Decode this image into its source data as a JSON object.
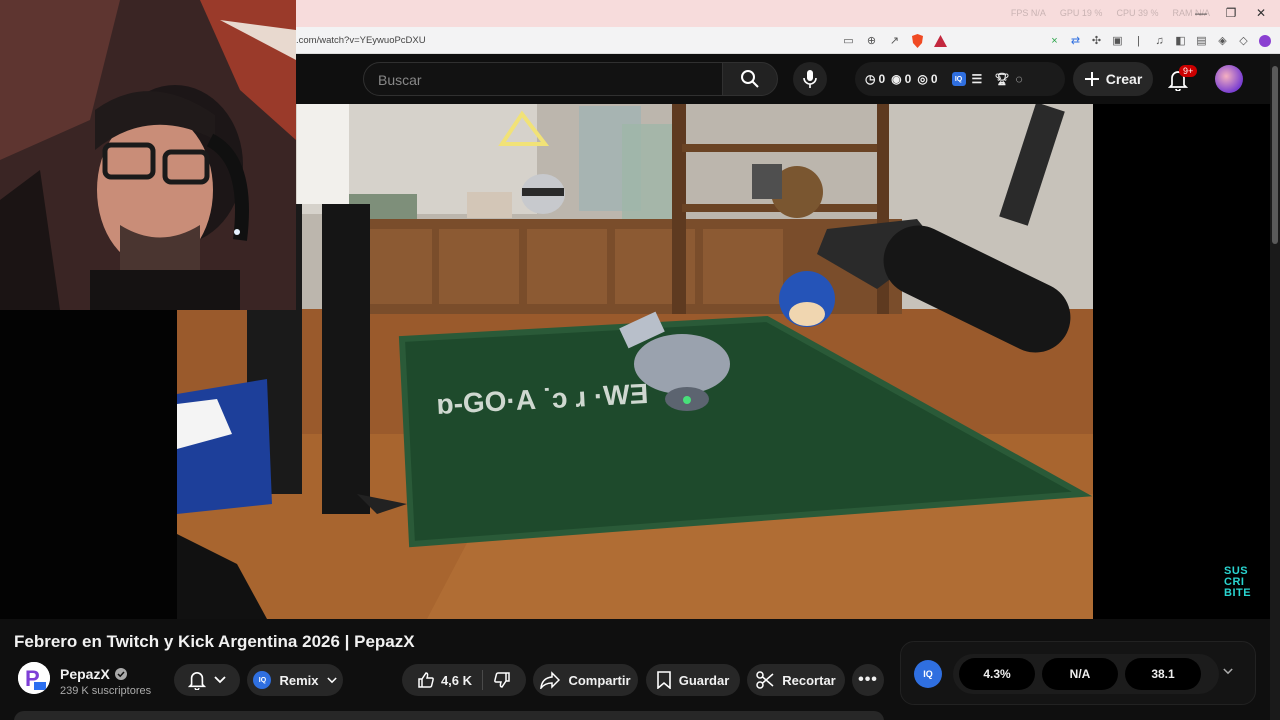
{
  "browser": {
    "url": ".com/watch?v=YEywuoPcDXU",
    "os_stats": [
      "FPS N/A",
      "GPU 19 %",
      "CPU 39 %",
      "RAM N/A"
    ]
  },
  "header": {
    "search_placeholder": "Buscar",
    "counters": [
      {
        "icon": "clock-icon",
        "value": "0"
      },
      {
        "icon": "eye-icon",
        "value": "0"
      },
      {
        "icon": "eye-off-icon",
        "value": "0"
      }
    ],
    "create_label": "Crear",
    "notif_badge": "9+"
  },
  "video": {
    "title": "Febrero en Twitch y Kick Argentina 2026 | PepazX",
    "watermark": "SUS CRI BITE"
  },
  "channel": {
    "name": "PepazX",
    "subscribers": "239 K suscriptores"
  },
  "actions": {
    "remix_label": "Remix",
    "like_count": "4,6 K",
    "share_label": "Compartir",
    "save_label": "Guardar",
    "clip_label": "Recortar"
  },
  "stats": {
    "badge": "IQ",
    "values": [
      "4.3%",
      "N/A",
      "38.1"
    ]
  },
  "colors": {
    "accent_blue": "#2f6fe0",
    "notif_red": "#cc0000",
    "watermark_cyan": "#2ad4d0"
  }
}
